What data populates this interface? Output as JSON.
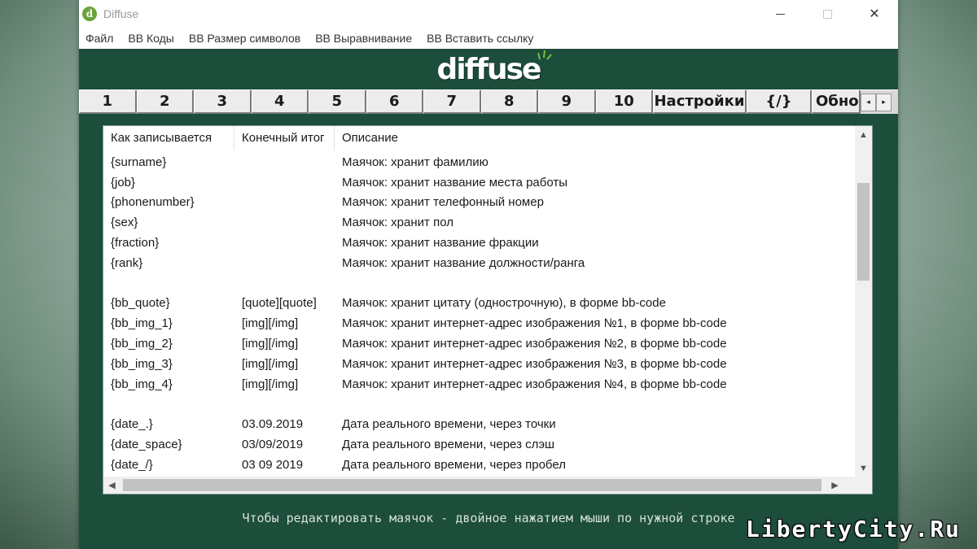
{
  "window": {
    "title": "Diffuse",
    "icon_letter": "d",
    "controls": {
      "minimize": "—",
      "maximize": "",
      "close": "✕"
    }
  },
  "menu": {
    "items": [
      {
        "label": "Файл"
      },
      {
        "label": "BB Коды"
      },
      {
        "label": "BB Размер символов"
      },
      {
        "label": "BB Выравнивание"
      },
      {
        "label": "BB Вставить ссылку"
      }
    ]
  },
  "logo": {
    "text": "diffuse"
  },
  "tabs": {
    "items": [
      {
        "label": "1"
      },
      {
        "label": "2"
      },
      {
        "label": "3"
      },
      {
        "label": "4"
      },
      {
        "label": "5"
      },
      {
        "label": "6"
      },
      {
        "label": "7"
      },
      {
        "label": "8"
      },
      {
        "label": "9"
      },
      {
        "label": "10"
      },
      {
        "label": "Настройки"
      },
      {
        "label": "{/}"
      },
      {
        "label": "Обнов"
      }
    ],
    "scroll_left": "◂",
    "scroll_right": "▸"
  },
  "list": {
    "columns": [
      {
        "label": "Как записывается"
      },
      {
        "label": "Конечный итог"
      },
      {
        "label": "Описание"
      }
    ],
    "rows": [
      {
        "syntax": "{surname}",
        "result": "",
        "desc": "Маячок: хранит фамилию"
      },
      {
        "syntax": "{job}",
        "result": "",
        "desc": "Маячок: хранит название места работы"
      },
      {
        "syntax": "{phonenumber}",
        "result": "",
        "desc": "Маячок: хранит телефонный номер"
      },
      {
        "syntax": "{sex}",
        "result": "",
        "desc": "Маячок: хранит пол"
      },
      {
        "syntax": "{fraction}",
        "result": "",
        "desc": "Маячок: хранит название фракции"
      },
      {
        "syntax": "{rank}",
        "result": "",
        "desc": "Маячок: хранит название должности/ранга"
      },
      {
        "syntax": "",
        "result": "",
        "desc": ""
      },
      {
        "syntax": "{bb_quote}",
        "result": "[quote][quote]",
        "desc": "Маячок: хранит цитату (однострочную), в форме bb-code"
      },
      {
        "syntax": "{bb_img_1}",
        "result": "[img][/img]",
        "desc": "Маячок: хранит интернет-адрес изображения №1, в форме bb-code"
      },
      {
        "syntax": "{bb_img_2}",
        "result": "[img][/img]",
        "desc": "Маячок: хранит интернет-адрес изображения №2, в форме bb-code"
      },
      {
        "syntax": "{bb_img_3}",
        "result": "[img][/img]",
        "desc": "Маячок: хранит интернет-адрес изображения №3, в форме bb-code"
      },
      {
        "syntax": "{bb_img_4}",
        "result": "[img][/img]",
        "desc": "Маячок: хранит интернет-адрес изображения №4, в форме bb-code"
      },
      {
        "syntax": "",
        "result": "",
        "desc": ""
      },
      {
        "syntax": "{date_.}",
        "result": "03.09.2019",
        "desc": "Дата реального времени, через точки"
      },
      {
        "syntax": "{date_space}",
        "result": "03/09/2019",
        "desc": "Дата реального времени, через слэш"
      },
      {
        "syntax": "{date_/}",
        "result": "03 09 2019",
        "desc": "Дата реального времени, через пробел"
      }
    ],
    "scroll_up": "▲",
    "scroll_down": "▼",
    "scroll_left": "◀",
    "scroll_right": "▶"
  },
  "status": {
    "hint": "Чтобы редактировать маячок - двойное нажатием мыши по нужной строке"
  },
  "watermark": {
    "text": "LibertyCity.Ru"
  },
  "colors": {
    "window_bg": "#1d4d3b",
    "logo_accent": "#7bc043"
  }
}
